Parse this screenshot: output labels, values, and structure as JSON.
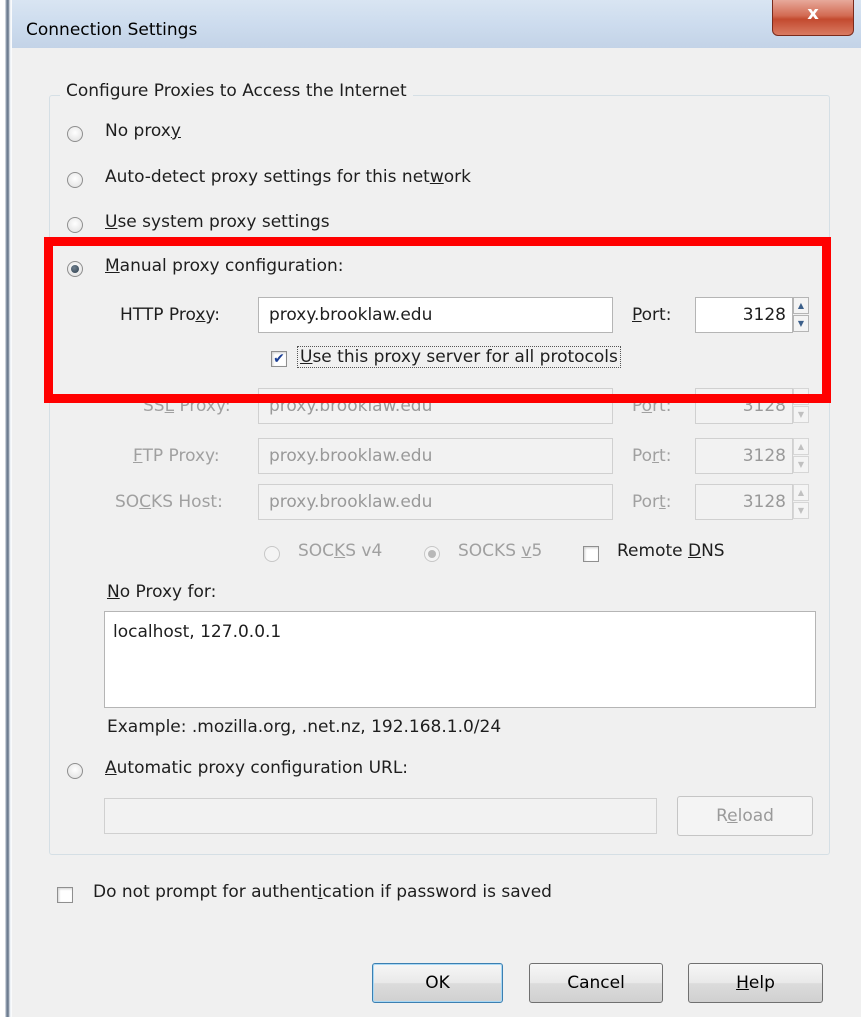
{
  "window": {
    "title": "Connection Settings",
    "close_symbol": "x"
  },
  "group": {
    "legend": "Configure Proxies to Access the Internet"
  },
  "radios": {
    "no_proxy": {
      "pre": "No prox",
      "mn": "y",
      "post": ""
    },
    "auto_detect": {
      "pre": "Auto-detect proxy settings for this net",
      "mn": "w",
      "post": "ork"
    },
    "system": {
      "pre": "",
      "mn": "U",
      "post": "se system proxy settings"
    },
    "manual": {
      "pre": "",
      "mn": "M",
      "post": "anual proxy configuration:"
    },
    "auto_url": {
      "pre": "",
      "mn": "A",
      "post": "utomatic proxy configuration URL:"
    }
  },
  "proxies": {
    "http": {
      "label_pre": "HTTP Pro",
      "label_mn": "x",
      "label_post": "y:",
      "value": "proxy.brooklaw.edu",
      "port_label_pre": "",
      "port_label_mn": "P",
      "port_label_post": "ort:",
      "port": "3128"
    },
    "ssl": {
      "label_pre": "SS",
      "label_mn": "L",
      "label_post": " Proxy:",
      "value": "proxy.brooklaw.edu",
      "port_label_pre": "P",
      "port_label_mn": "o",
      "port_label_post": "rt:",
      "port": "3128"
    },
    "ftp": {
      "label_pre": "",
      "label_mn": "F",
      "label_post": "TP Proxy:",
      "value": "proxy.brooklaw.edu",
      "port_label_pre": "Po",
      "port_label_mn": "r",
      "port_label_post": "t:",
      "port": "3128"
    },
    "socks": {
      "label_pre": "SO",
      "label_mn": "C",
      "label_post": "KS Host:",
      "value": "proxy.brooklaw.edu",
      "port_label_pre": "Por",
      "port_label_mn": "t",
      "port_label_post": ":",
      "port": "3128"
    }
  },
  "use_for_all": {
    "pre": "",
    "mn": "U",
    "post": "se this proxy server for all protocols",
    "checked": true
  },
  "socks_versions": {
    "v4": {
      "pre": "SOC",
      "mn": "K",
      "post": "S v4",
      "checked": false
    },
    "v5": {
      "pre": "SOCKS ",
      "mn": "v",
      "post": "5",
      "checked": true
    }
  },
  "remote_dns": {
    "pre": "Remote ",
    "mn": "D",
    "post": "NS",
    "checked": false
  },
  "no_proxy_for": {
    "label_pre": "",
    "label_mn": "N",
    "label_post": "o Proxy for:",
    "value": "localhost, 127.0.0.1"
  },
  "example_text": "Example: .mozilla.org, .net.nz, 192.168.1.0/24",
  "auto_url": {
    "value": "",
    "reload_pre": "R",
    "reload_mn": "e",
    "reload_post": "load"
  },
  "no_auth_prompt": {
    "pre": "Do not prompt for authent",
    "mn": "i",
    "post": "cation if password is saved",
    "checked": false
  },
  "buttons": {
    "ok": "OK",
    "cancel": "Cancel",
    "help": {
      "pre": "",
      "mn": "H",
      "post": "elp"
    }
  },
  "colors": {
    "highlight": "#ff0000",
    "dialog_bg": "#f0f0f0",
    "close_button": "#c7573e"
  }
}
